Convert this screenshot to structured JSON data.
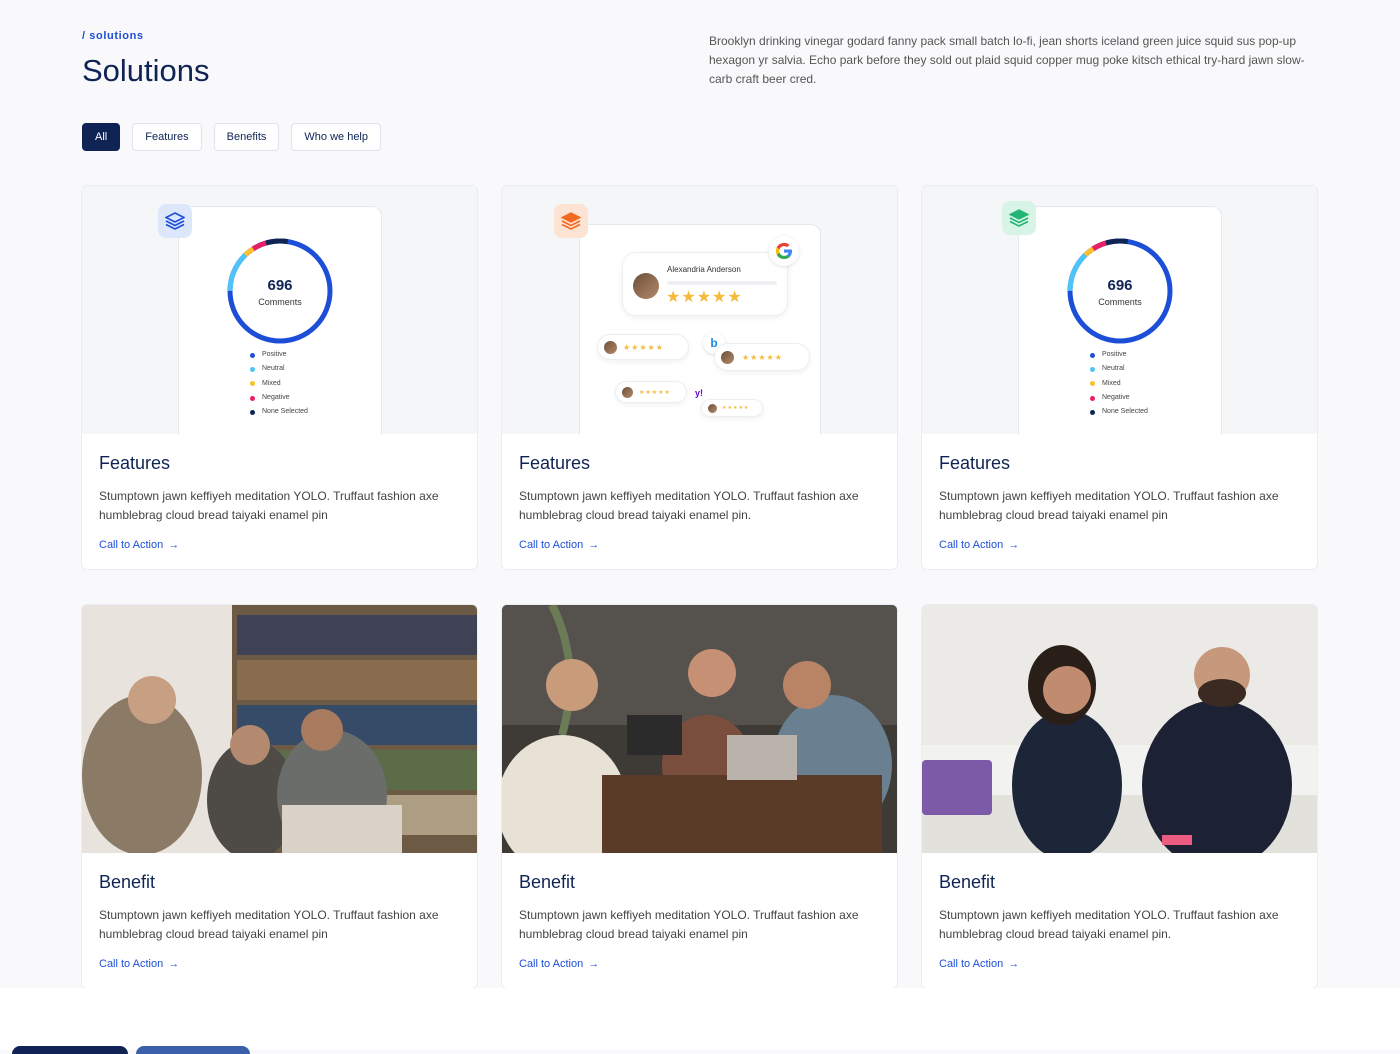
{
  "breadcrumb": "/ solutions",
  "title": "Solutions",
  "intro": "Brooklyn drinking vinegar godard fanny pack small batch lo-fi, jean shorts iceland green juice squid sus pop-up hexagon yr salvia. Echo park before they sold out plaid squid copper mug poke kitsch ethical try-hard jawn slow-carb craft beer cred.",
  "filters": [
    "All",
    "Features",
    "Benefits",
    "Who we help"
  ],
  "active_filter": "All",
  "colors": {
    "navy": "#0f2454",
    "link": "#1d4ed8",
    "positive": "#1d4ed8",
    "neutral": "#4fc3f7",
    "mixed": "#fbc02d",
    "negative": "#e91e63",
    "none": "#0f2454"
  },
  "widget": {
    "count": "696",
    "label": "Comments",
    "legend": [
      "Positive",
      "Neutral",
      "Mixed",
      "Negative",
      "None Selected"
    ]
  },
  "review_widget": {
    "reviewer": "Alexandria Anderson",
    "stars": "★★★★★",
    "small_stars": "★★★★★"
  },
  "cards": [
    {
      "title": "Features",
      "text": "Stumptown jawn keffiyeh meditation YOLO. Truffaut fashion axe humblebrag cloud bread taiyaki enamel pin",
      "cta": "Call to Action",
      "icon": "stack-icon",
      "icon_color": "#1d4ed8"
    },
    {
      "title": "Features",
      "text": "Stumptown jawn keffiyeh meditation YOLO. Truffaut fashion axe humblebrag cloud bread taiyaki enamel pin.",
      "cta": "Call to Action",
      "icon": "stack-icon",
      "icon_color": "#f26a21"
    },
    {
      "title": "Features",
      "text": "Stumptown jawn keffiyeh meditation YOLO. Truffaut fashion axe humblebrag cloud bread taiyaki enamel pin",
      "cta": "Call to Action",
      "icon": "stack-icon",
      "icon_color": "#22b573"
    },
    {
      "title": "Benefit",
      "text": "Stumptown jawn keffiyeh meditation YOLO. Truffaut fashion axe humblebrag cloud bread taiyaki enamel pin",
      "cta": "Call to Action"
    },
    {
      "title": "Benefit",
      "text": "Stumptown jawn keffiyeh meditation YOLO. Truffaut fashion axe humblebrag cloud bread taiyaki enamel pin",
      "cta": "Call to Action"
    },
    {
      "title": "Benefit",
      "text": "Stumptown jawn keffiyeh meditation YOLO. Truffaut fashion axe humblebrag cloud bread taiyaki enamel pin.",
      "cta": "Call to Action"
    }
  ]
}
